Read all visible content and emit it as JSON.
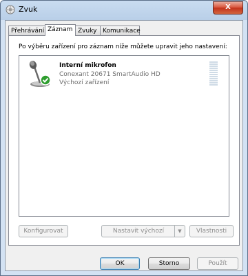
{
  "window": {
    "title": "Zvuk",
    "close_label": "X"
  },
  "tabs": [
    {
      "label": "Přehrávání"
    },
    {
      "label": "Záznam"
    },
    {
      "label": "Zvuky"
    },
    {
      "label": "Komunikace"
    }
  ],
  "active_tab": "Záznam",
  "panel": {
    "instruction": "Po výběru zařízení pro záznam níže můžete upravit jeho nastavení:"
  },
  "devices": [
    {
      "name": "Interní mikrofon",
      "driver": "Conexant 20671 SmartAudio HD",
      "status": "Výchozí zařízení",
      "icon": "microphone-icon",
      "default_badge": "check-icon"
    }
  ],
  "panel_buttons": {
    "configure": "Konfigurovat",
    "set_default": "Nastavit výchozí",
    "properties": "Vlastnosti"
  },
  "dialog_buttons": {
    "ok": "OK",
    "cancel": "Storno",
    "apply": "Použít"
  },
  "colors": {
    "title_gradient": "#c9dcf0",
    "close_red": "#c3321c",
    "check_green": "#2f9e2f"
  }
}
